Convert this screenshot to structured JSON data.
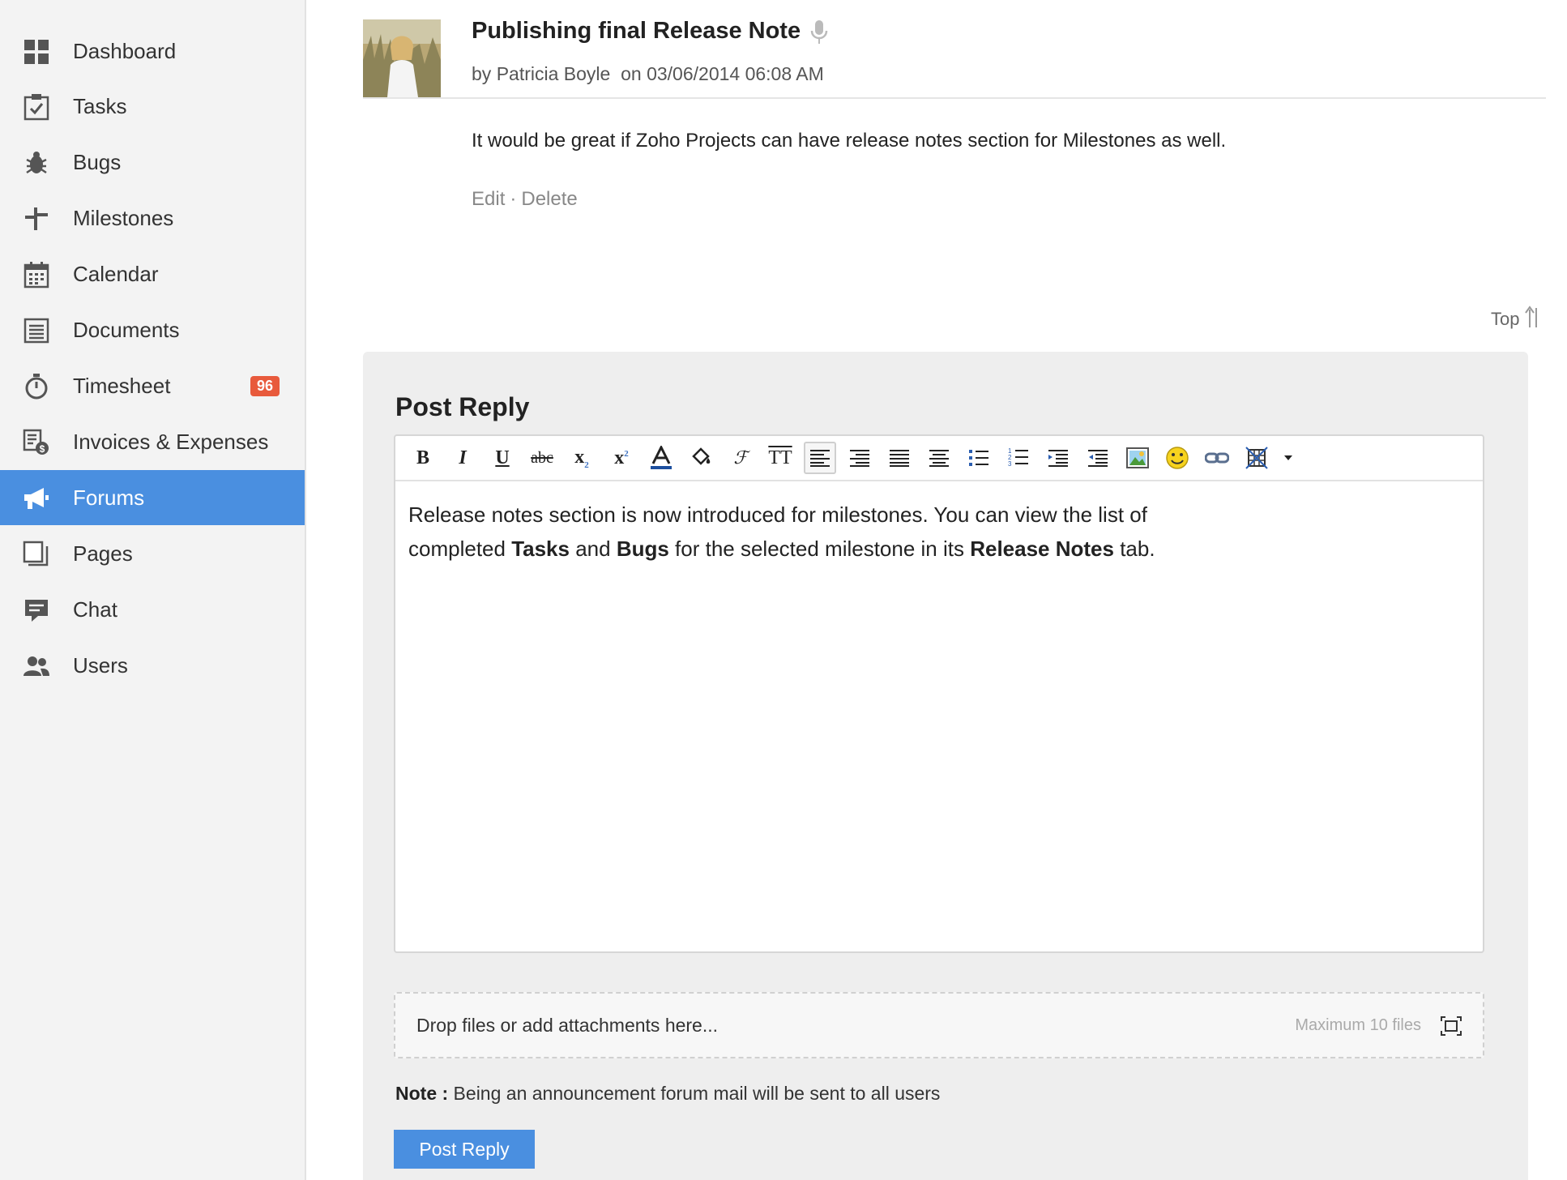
{
  "sidebar": {
    "items": [
      {
        "label": "Dashboard",
        "icon": "dashboard-icon"
      },
      {
        "label": "Tasks",
        "icon": "tasks-icon"
      },
      {
        "label": "Bugs",
        "icon": "bug-icon"
      },
      {
        "label": "Milestones",
        "icon": "milestone-icon"
      },
      {
        "label": "Calendar",
        "icon": "calendar-icon"
      },
      {
        "label": "Documents",
        "icon": "documents-icon"
      },
      {
        "label": "Timesheet",
        "icon": "timer-icon",
        "badge": "96"
      },
      {
        "label": "Invoices & Expenses",
        "icon": "invoice-icon"
      },
      {
        "label": "Forums",
        "icon": "megaphone-icon",
        "active": true
      },
      {
        "label": "Pages",
        "icon": "pages-icon"
      },
      {
        "label": "Chat",
        "icon": "chat-icon"
      },
      {
        "label": "Users",
        "icon": "users-icon"
      }
    ]
  },
  "post": {
    "title": "Publishing final Release Note",
    "author_prefix": "by",
    "author": "Patricia Boyle",
    "date_prefix": "on",
    "date": "03/06/2014 06:08 AM",
    "body": "It would be great if Zoho Projects can have release notes section for Milestones as well.",
    "edit_label": "Edit",
    "separator": "·",
    "delete_label": "Delete"
  },
  "top_link": "Top",
  "reply": {
    "heading": "Post Reply",
    "toolbar": [
      "bold",
      "italic",
      "underline",
      "strikethrough",
      "subscript",
      "superscript",
      "font-color",
      "background-color",
      "font-family",
      "font-size",
      "align-left",
      "align-right",
      "justify",
      "align-center",
      "bulleted-list",
      "numbered-list",
      "indent",
      "outdent",
      "insert-image",
      "insert-emoticon",
      "insert-link",
      "insert-table",
      "more-dropdown"
    ],
    "content_line1": "Release notes section is now introduced for milestones. You can view the list of",
    "content_line2_a": "completed ",
    "content_bold_tasks": "Tasks",
    "content_and": " and ",
    "content_bold_bugs": "Bugs",
    "content_line2_b": " for the selected milestone in its ",
    "content_bold_release": "Release Notes",
    "content_line2_c": " tab.",
    "dropzone_text": "Drop files or add attachments here...",
    "dropzone_max": "Maximum 10 files",
    "note_label": "Note :",
    "note_text": " Being an announcement forum mail will be sent to all users",
    "submit_label": "Post Reply"
  },
  "colors": {
    "accent": "#4a8fe0",
    "badge": "#e85a3c",
    "sidebar_bg": "#f3f3f3"
  }
}
